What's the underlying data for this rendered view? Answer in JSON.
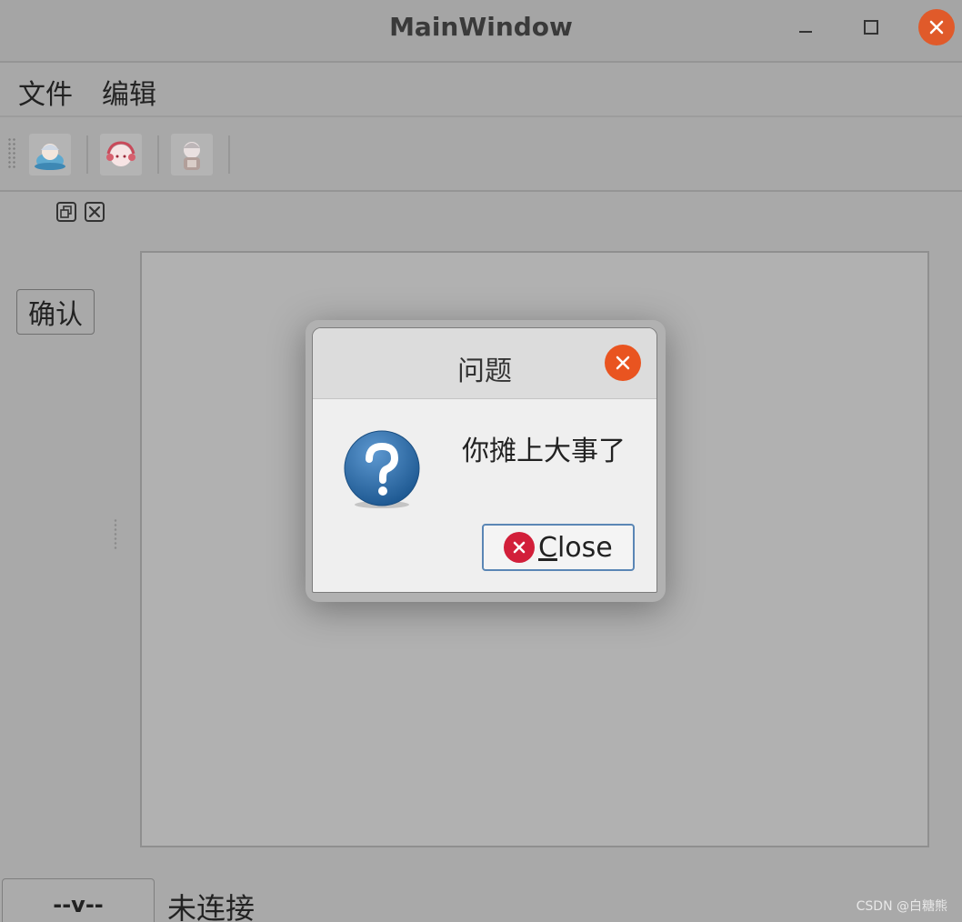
{
  "window": {
    "title": "MainWindow"
  },
  "menubar": {
    "items": [
      {
        "label": "文件"
      },
      {
        "label": "编辑"
      }
    ]
  },
  "toolbar": {
    "buttons": [
      {
        "icon": "character-avatar-blue-icon"
      },
      {
        "icon": "character-avatar-pink-icon"
      },
      {
        "icon": "character-avatar-gray-icon"
      }
    ]
  },
  "dock": {
    "confirm_label": "确认"
  },
  "statusbar": {
    "combo_value": "--v--",
    "connection_status": "未连接"
  },
  "dialog": {
    "title": "问题",
    "message": "你摊上大事了",
    "close_button": {
      "mnemonic": "C",
      "rest": "lose"
    },
    "icon": "question-icon"
  },
  "watermark": "CSDN @白糖熊",
  "colors": {
    "window_bg": "#a9a9a9",
    "close_orange": "#e95420",
    "dialog_bg": "#efefef",
    "question_blue": "#2f6aa3",
    "close_red": "#d21f3a"
  }
}
